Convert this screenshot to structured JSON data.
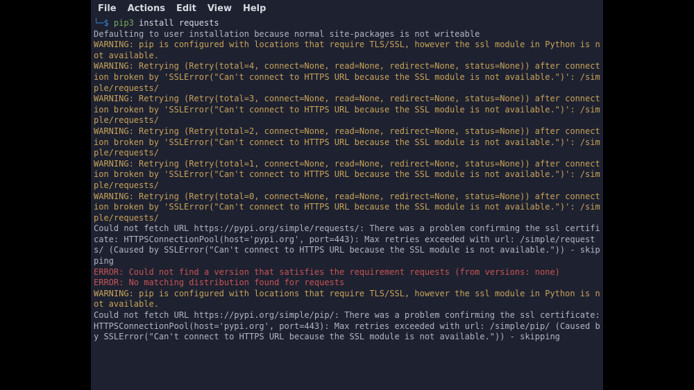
{
  "menubar": {
    "file": "File",
    "actions": "Actions",
    "edit": "Edit",
    "view": "View",
    "help": "Help"
  },
  "prompt": {
    "path": "└─",
    "symbol": "$",
    "cmd_green": "pip3",
    "cmd_rest": " install requests"
  },
  "lines": {
    "l0": "Defaulting to user installation because normal site-packages is not writeable",
    "l1": "WARNING: pip is configured with locations that require TLS/SSL, however the ssl module in Python is not available.",
    "l2": "WARNING: Retrying (Retry(total=4, connect=None, read=None, redirect=None, status=None)) after connection broken by 'SSLError(\"Can't connect to HTTPS URL because the SSL module is not available.\")': /simple/requests/",
    "l3": "WARNING: Retrying (Retry(total=3, connect=None, read=None, redirect=None, status=None)) after connection broken by 'SSLError(\"Can't connect to HTTPS URL because the SSL module is not available.\")': /simple/requests/",
    "l4": "WARNING: Retrying (Retry(total=2, connect=None, read=None, redirect=None, status=None)) after connection broken by 'SSLError(\"Can't connect to HTTPS URL because the SSL module is not available.\")': /simple/requests/",
    "l5": "WARNING: Retrying (Retry(total=1, connect=None, read=None, redirect=None, status=None)) after connection broken by 'SSLError(\"Can't connect to HTTPS URL because the SSL module is not available.\")': /simple/requests/",
    "l6": "WARNING: Retrying (Retry(total=0, connect=None, read=None, redirect=None, status=None)) after connection broken by 'SSLError(\"Can't connect to HTTPS URL because the SSL module is not available.\")': /simple/requests/",
    "l7": "Could not fetch URL https://pypi.org/simple/requests/: There was a problem confirming the ssl certificate: HTTPSConnectionPool(host='pypi.org', port=443): Max retries exceeded with url: /simple/requests/ (Caused by SSLError(\"Can't connect to HTTPS URL because the SSL module is not available.\")) - skipping",
    "l8": "ERROR: Could not find a version that satisfies the requirement requests (from versions: none)",
    "l9": "ERROR: No matching distribution found for requests",
    "l10": "WARNING: pip is configured with locations that require TLS/SSL, however the ssl module in Python is not available.",
    "l11": "Could not fetch URL https://pypi.org/simple/pip/: There was a problem confirming the ssl certificate: HTTPSConnectionPool(host='pypi.org', port=443): Max retries exceeded with url: /simple/pip/ (Caused by SSLError(\"Can't connect to HTTPS URL because the SSL module is not available.\")) - skipping"
  }
}
